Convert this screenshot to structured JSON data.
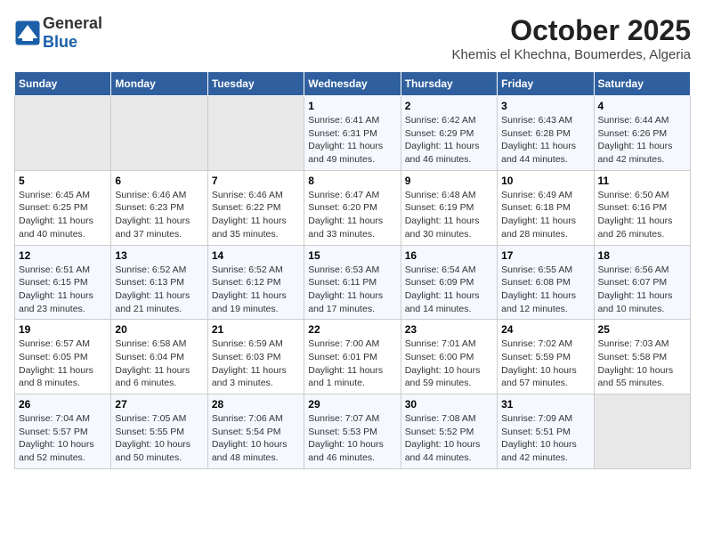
{
  "header": {
    "logo_general": "General",
    "logo_blue": "Blue",
    "title": "October 2025",
    "subtitle": "Khemis el Khechna, Boumerdes, Algeria"
  },
  "calendar": {
    "days_of_week": [
      "Sunday",
      "Monday",
      "Tuesday",
      "Wednesday",
      "Thursday",
      "Friday",
      "Saturday"
    ],
    "weeks": [
      [
        {
          "day": "",
          "detail": ""
        },
        {
          "day": "",
          "detail": ""
        },
        {
          "day": "",
          "detail": ""
        },
        {
          "day": "1",
          "detail": "Sunrise: 6:41 AM\nSunset: 6:31 PM\nDaylight: 11 hours\nand 49 minutes."
        },
        {
          "day": "2",
          "detail": "Sunrise: 6:42 AM\nSunset: 6:29 PM\nDaylight: 11 hours\nand 46 minutes."
        },
        {
          "day": "3",
          "detail": "Sunrise: 6:43 AM\nSunset: 6:28 PM\nDaylight: 11 hours\nand 44 minutes."
        },
        {
          "day": "4",
          "detail": "Sunrise: 6:44 AM\nSunset: 6:26 PM\nDaylight: 11 hours\nand 42 minutes."
        }
      ],
      [
        {
          "day": "5",
          "detail": "Sunrise: 6:45 AM\nSunset: 6:25 PM\nDaylight: 11 hours\nand 40 minutes."
        },
        {
          "day": "6",
          "detail": "Sunrise: 6:46 AM\nSunset: 6:23 PM\nDaylight: 11 hours\nand 37 minutes."
        },
        {
          "day": "7",
          "detail": "Sunrise: 6:46 AM\nSunset: 6:22 PM\nDaylight: 11 hours\nand 35 minutes."
        },
        {
          "day": "8",
          "detail": "Sunrise: 6:47 AM\nSunset: 6:20 PM\nDaylight: 11 hours\nand 33 minutes."
        },
        {
          "day": "9",
          "detail": "Sunrise: 6:48 AM\nSunset: 6:19 PM\nDaylight: 11 hours\nand 30 minutes."
        },
        {
          "day": "10",
          "detail": "Sunrise: 6:49 AM\nSunset: 6:18 PM\nDaylight: 11 hours\nand 28 minutes."
        },
        {
          "day": "11",
          "detail": "Sunrise: 6:50 AM\nSunset: 6:16 PM\nDaylight: 11 hours\nand 26 minutes."
        }
      ],
      [
        {
          "day": "12",
          "detail": "Sunrise: 6:51 AM\nSunset: 6:15 PM\nDaylight: 11 hours\nand 23 minutes."
        },
        {
          "day": "13",
          "detail": "Sunrise: 6:52 AM\nSunset: 6:13 PM\nDaylight: 11 hours\nand 21 minutes."
        },
        {
          "day": "14",
          "detail": "Sunrise: 6:52 AM\nSunset: 6:12 PM\nDaylight: 11 hours\nand 19 minutes."
        },
        {
          "day": "15",
          "detail": "Sunrise: 6:53 AM\nSunset: 6:11 PM\nDaylight: 11 hours\nand 17 minutes."
        },
        {
          "day": "16",
          "detail": "Sunrise: 6:54 AM\nSunset: 6:09 PM\nDaylight: 11 hours\nand 14 minutes."
        },
        {
          "day": "17",
          "detail": "Sunrise: 6:55 AM\nSunset: 6:08 PM\nDaylight: 11 hours\nand 12 minutes."
        },
        {
          "day": "18",
          "detail": "Sunrise: 6:56 AM\nSunset: 6:07 PM\nDaylight: 11 hours\nand 10 minutes."
        }
      ],
      [
        {
          "day": "19",
          "detail": "Sunrise: 6:57 AM\nSunset: 6:05 PM\nDaylight: 11 hours\nand 8 minutes."
        },
        {
          "day": "20",
          "detail": "Sunrise: 6:58 AM\nSunset: 6:04 PM\nDaylight: 11 hours\nand 6 minutes."
        },
        {
          "day": "21",
          "detail": "Sunrise: 6:59 AM\nSunset: 6:03 PM\nDaylight: 11 hours\nand 3 minutes."
        },
        {
          "day": "22",
          "detail": "Sunrise: 7:00 AM\nSunset: 6:01 PM\nDaylight: 11 hours\nand 1 minute."
        },
        {
          "day": "23",
          "detail": "Sunrise: 7:01 AM\nSunset: 6:00 PM\nDaylight: 10 hours\nand 59 minutes."
        },
        {
          "day": "24",
          "detail": "Sunrise: 7:02 AM\nSunset: 5:59 PM\nDaylight: 10 hours\nand 57 minutes."
        },
        {
          "day": "25",
          "detail": "Sunrise: 7:03 AM\nSunset: 5:58 PM\nDaylight: 10 hours\nand 55 minutes."
        }
      ],
      [
        {
          "day": "26",
          "detail": "Sunrise: 7:04 AM\nSunset: 5:57 PM\nDaylight: 10 hours\nand 52 minutes."
        },
        {
          "day": "27",
          "detail": "Sunrise: 7:05 AM\nSunset: 5:55 PM\nDaylight: 10 hours\nand 50 minutes."
        },
        {
          "day": "28",
          "detail": "Sunrise: 7:06 AM\nSunset: 5:54 PM\nDaylight: 10 hours\nand 48 minutes."
        },
        {
          "day": "29",
          "detail": "Sunrise: 7:07 AM\nSunset: 5:53 PM\nDaylight: 10 hours\nand 46 minutes."
        },
        {
          "day": "30",
          "detail": "Sunrise: 7:08 AM\nSunset: 5:52 PM\nDaylight: 10 hours\nand 44 minutes."
        },
        {
          "day": "31",
          "detail": "Sunrise: 7:09 AM\nSunset: 5:51 PM\nDaylight: 10 hours\nand 42 minutes."
        },
        {
          "day": "",
          "detail": ""
        }
      ]
    ]
  }
}
